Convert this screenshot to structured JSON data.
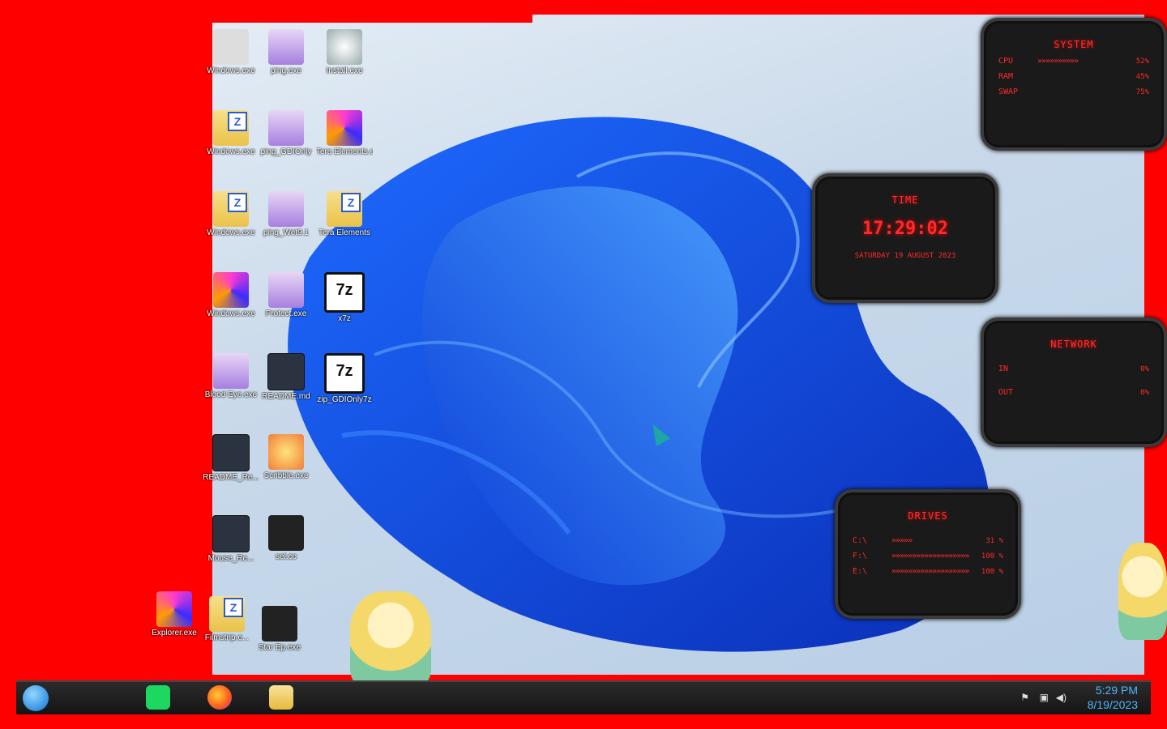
{
  "desktop_icons": [
    {
      "label": "Windows.exe"
    },
    {
      "label": "ping.exe"
    },
    {
      "label": "Install.exe"
    },
    {
      "label": "Windows.exe"
    },
    {
      "label": "ping_GDIOnly"
    },
    {
      "label": "Tera Elements.exe"
    },
    {
      "label": "Windows.exe"
    },
    {
      "label": "ping_Wet9.1"
    },
    {
      "label": "Tera Elements"
    },
    {
      "label": "Windows.exe"
    },
    {
      "label": "Protect.exe"
    },
    {
      "label": "x7z"
    },
    {
      "label": "Blood Eye.exe"
    },
    {
      "label": "README.md"
    },
    {
      "label": "zip_GDIOnly7z"
    },
    {
      "label": "README_Re..."
    },
    {
      "label": "Scribble.exe"
    },
    {
      "label": "Mouse_Re..."
    },
    {
      "label": "sel.co"
    },
    {
      "label": "Explorer.exe"
    },
    {
      "label": "Filmstrip.e..."
    },
    {
      "label": "Star Ep.exe"
    }
  ],
  "widgets": {
    "system": {
      "title": "SYSTEM",
      "rows": [
        {
          "k": "CPU",
          "bar": "»»»»»»»»»»",
          "v": "52%"
        },
        {
          "k": "RAM",
          "bar": "",
          "v": "45%"
        },
        {
          "k": "SWAP",
          "bar": "",
          "v": "75%"
        }
      ]
    },
    "time": {
      "title": "TIME",
      "clock": "17:29:02",
      "date": "SATURDAY 19 AUGUST 2023"
    },
    "network": {
      "title": "NETWORK",
      "rows": [
        {
          "k": "IN",
          "bar": "",
          "v": "0%"
        },
        {
          "k": "OUT",
          "bar": "",
          "v": "0%"
        }
      ]
    },
    "drives": {
      "title": "DRIVES",
      "rows": [
        {
          "k": "C:\\",
          "bar": "»»»»»",
          "v": "31 %"
        },
        {
          "k": "F:\\",
          "bar": "»»»»»»»»»»»»»»»»»»»",
          "v": "100 %"
        },
        {
          "k": "E:\\",
          "bar": "»»»»»»»»»»»»»»»»»»»",
          "v": "100 %"
        }
      ]
    }
  },
  "taskbar": {
    "apps": [
      "task-manager",
      "firefox",
      "file-explorer"
    ],
    "clock_time": "5:29 PM",
    "clock_date": "8/19/2023"
  },
  "colors": {
    "accent": "#ff2a2a",
    "background": "#ff0000",
    "clock": "#4fb6ff"
  }
}
